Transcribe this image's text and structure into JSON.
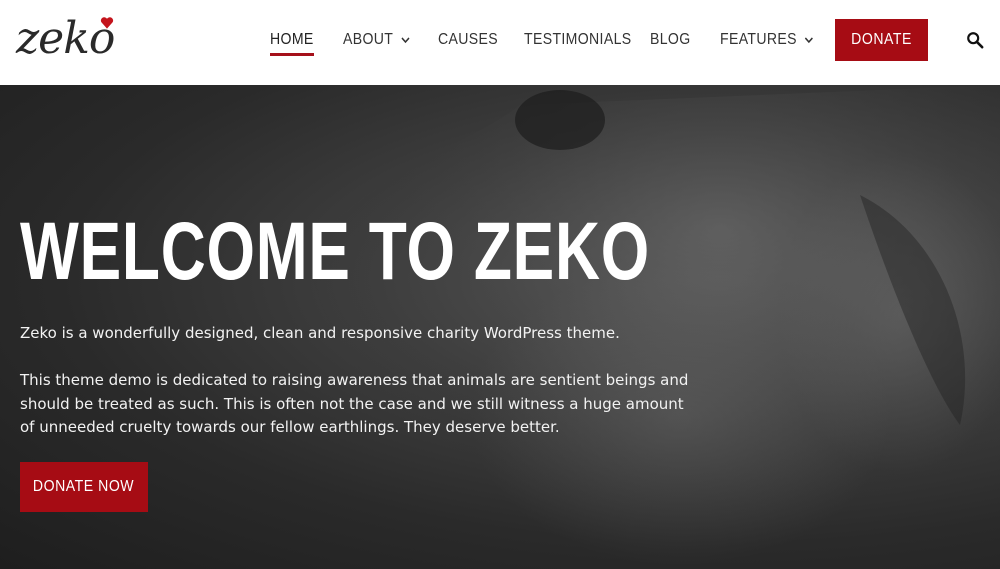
{
  "header": {
    "logo_text": "zeko",
    "nav": [
      {
        "label": "HOME",
        "active": true
      },
      {
        "label": "ABOUT",
        "has_dropdown": true
      },
      {
        "label": "CAUSES"
      },
      {
        "label": "TESTIMONIALS"
      },
      {
        "label": "BLOG"
      },
      {
        "label": "FEATURES",
        "has_dropdown": true
      }
    ],
    "donate_label": "DONATE",
    "search_icon": "search-icon"
  },
  "hero": {
    "title": "WELCOME TO ZEKO",
    "paragraph1": "Zeko is a wonderfully designed, clean and responsive charity WordPress theme.",
    "paragraph2": "This theme demo is dedicated to raising awareness that animals are sentient beings and should be treated as such. This is often not the case and we still witness a huge amount of unneeded cruelty towards our fellow earthlings. They deserve better.",
    "button_label": "DONATE NOW"
  },
  "colors": {
    "accent": "#a60c14",
    "hero_bg": "#2e2e2e",
    "nav_text": "#333333"
  }
}
